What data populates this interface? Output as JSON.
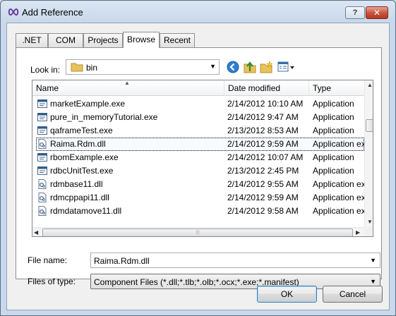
{
  "window": {
    "title": "Add Reference",
    "help_label": "?",
    "close_label": "✕"
  },
  "tabs": [
    {
      "label": ".NET",
      "active": false
    },
    {
      "label": "COM",
      "active": false
    },
    {
      "label": "Projects",
      "active": false
    },
    {
      "label": "Browse",
      "active": true
    },
    {
      "label": "Recent",
      "active": false
    }
  ],
  "browse": {
    "look_in_label": "Look in:",
    "look_in_value": "bin",
    "toolbar_icons": [
      "back-icon",
      "up-folder-icon",
      "new-folder-icon",
      "view-menu-icon"
    ],
    "columns": [
      "Name",
      "Date modified",
      "Type"
    ],
    "files": [
      {
        "name": "marketExample.exe",
        "date": "2/14/2012 10:10 AM",
        "type": "Application",
        "icon": "exe-icon"
      },
      {
        "name": "pure_in_memoryTutorial.exe",
        "date": "2/14/2012 9:47 AM",
        "type": "Application",
        "icon": "exe-icon"
      },
      {
        "name": "qaframeTest.exe",
        "date": "2/13/2012 8:53 AM",
        "type": "Application",
        "icon": "exe-icon"
      },
      {
        "name": "Raima.Rdm.dll",
        "date": "2/14/2012 9:59 AM",
        "type": "Application ex",
        "icon": "dll-icon",
        "selected": true
      },
      {
        "name": "rbomExample.exe",
        "date": "2/14/2012 10:07 AM",
        "type": "Application",
        "icon": "exe-icon"
      },
      {
        "name": "rdbcUnitTest.exe",
        "date": "2/13/2012 2:45 PM",
        "type": "Application",
        "icon": "exe-icon"
      },
      {
        "name": "rdmbase11.dll",
        "date": "2/14/2012 9:55 AM",
        "type": "Application ex",
        "icon": "dll-icon"
      },
      {
        "name": "rdmcppapi11.dll",
        "date": "2/14/2012 9:59 AM",
        "type": "Application ex",
        "icon": "dll-icon"
      },
      {
        "name": "rdmdatamove11.dll",
        "date": "2/14/2012 9:58 AM",
        "type": "Application ex",
        "icon": "dll-icon"
      }
    ],
    "file_name_label": "File name:",
    "file_name_value": "Raima.Rdm.dll",
    "file_type_label": "Files of type:",
    "file_type_value": "Component Files (*.dll;*.tlb;*.olb;*.ocx;*.exe;*.manifest)"
  },
  "buttons": {
    "ok": "OK",
    "cancel": "Cancel"
  },
  "colors": {
    "selection_border": "#000000",
    "titlebar": "#dbe6f3",
    "close": "#c8513b"
  }
}
